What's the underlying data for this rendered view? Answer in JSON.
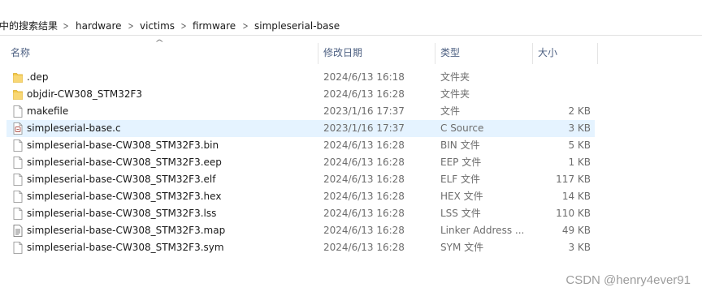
{
  "breadcrumb": {
    "items": [
      "中的搜索结果",
      "hardware",
      "victims",
      "firmware",
      "simpleserial-base"
    ]
  },
  "columns": {
    "name": "名称",
    "date": "修改日期",
    "type": "类型",
    "size": "大小"
  },
  "files": [
    {
      "name": ".dep",
      "date": "2024/6/13 16:18",
      "type": "文件夹",
      "size": "",
      "icon": "folder-icon"
    },
    {
      "name": "objdir-CW308_STM32F3",
      "date": "2024/6/13 16:28",
      "type": "文件夹",
      "size": "",
      "icon": "folder-icon"
    },
    {
      "name": "makefile",
      "date": "2023/1/16 17:37",
      "type": "文件",
      "size": "2 KB",
      "icon": "file-icon"
    },
    {
      "name": "simpleserial-base.c",
      "date": "2023/1/16 17:37",
      "type": "C Source",
      "size": "3 KB",
      "icon": "c-source-file-icon",
      "selected": true
    },
    {
      "name": "simpleserial-base-CW308_STM32F3.bin",
      "date": "2024/6/13 16:28",
      "type": "BIN 文件",
      "size": "5 KB",
      "icon": "file-icon"
    },
    {
      "name": "simpleserial-base-CW308_STM32F3.eep",
      "date": "2024/6/13 16:28",
      "type": "EEP 文件",
      "size": "1 KB",
      "icon": "file-icon"
    },
    {
      "name": "simpleserial-base-CW308_STM32F3.elf",
      "date": "2024/6/13 16:28",
      "type": "ELF 文件",
      "size": "117 KB",
      "icon": "file-icon"
    },
    {
      "name": "simpleserial-base-CW308_STM32F3.hex",
      "date": "2024/6/13 16:28",
      "type": "HEX 文件",
      "size": "14 KB",
      "icon": "file-icon"
    },
    {
      "name": "simpleserial-base-CW308_STM32F3.lss",
      "date": "2024/6/13 16:28",
      "type": "LSS 文件",
      "size": "110 KB",
      "icon": "file-icon"
    },
    {
      "name": "simpleserial-base-CW308_STM32F3.map",
      "date": "2024/6/13 16:28",
      "type": "Linker Address ...",
      "size": "49 KB",
      "icon": "map-file-icon"
    },
    {
      "name": "simpleserial-base-CW308_STM32F3.sym",
      "date": "2024/6/13 16:28",
      "type": "SYM 文件",
      "size": "3 KB",
      "icon": "file-icon"
    }
  ],
  "watermark": "CSDN @henry4ever91"
}
